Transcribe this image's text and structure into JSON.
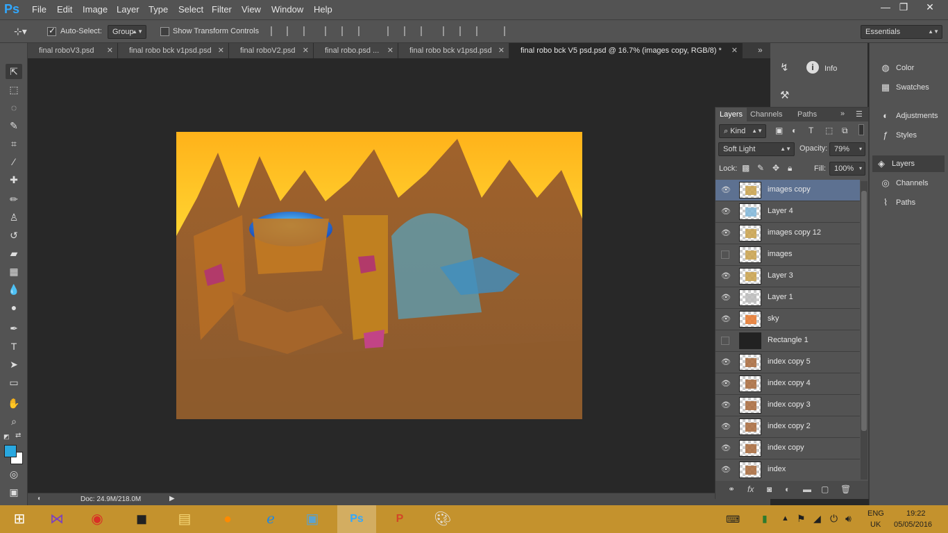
{
  "app": {
    "logo": "Ps"
  },
  "menu": [
    "File",
    "Edit",
    "Image",
    "Layer",
    "Type",
    "Select",
    "Filter",
    "View",
    "Window",
    "Help"
  ],
  "window_controls": {
    "minimize": "—",
    "maximize": "❐",
    "close": "✕"
  },
  "options": {
    "auto_select_label": "Auto-Select:",
    "auto_select_checked": true,
    "auto_select_value": "Group",
    "show_transform_label": "Show Transform Controls",
    "show_transform_checked": false,
    "workspace": "Essentials"
  },
  "tabs": [
    {
      "label": "final roboV3.psd"
    },
    {
      "label": "final robo bck v1psd.psd"
    },
    {
      "label": "final roboV2.psd"
    },
    {
      "label": "final robo.psd ..."
    },
    {
      "label": "final robo bck v1psd.psd"
    },
    {
      "label": "final robo bck V5 psd.psd @ 16.7% (images copy, RGB/8) *",
      "active": true
    }
  ],
  "tab_overflow": "»",
  "status": {
    "doc": "Doc: 24.9M/218.0M"
  },
  "right_dock_top": {
    "info_label": "Info"
  },
  "right_dock_side": [
    {
      "label": "Color",
      "icon": "color-icon"
    },
    {
      "label": "Swatches",
      "icon": "swatches-icon"
    },
    {
      "label": "Adjustments",
      "icon": "adjustments-icon"
    },
    {
      "label": "Styles",
      "icon": "styles-icon"
    },
    {
      "label": "Layers",
      "icon": "layers-icon",
      "active": true
    },
    {
      "label": "Channels",
      "icon": "channels-icon"
    },
    {
      "label": "Paths",
      "icon": "paths-icon"
    }
  ],
  "layers_panel": {
    "tabs": [
      "Layers",
      "Channels",
      "Paths"
    ],
    "filter_kind": "Kind",
    "blend_mode": "Soft Light",
    "opacity_label": "Opacity:",
    "opacity": "79%",
    "lock_label": "Lock:",
    "fill_label": "Fill:",
    "fill": "100%",
    "layers": [
      {
        "name": "images copy",
        "visible": true,
        "selected": true
      },
      {
        "name": "Layer 4",
        "visible": true
      },
      {
        "name": "images copy 12",
        "visible": true
      },
      {
        "name": "images",
        "visible": false
      },
      {
        "name": "Layer 3",
        "visible": true
      },
      {
        "name": "Layer 1",
        "visible": true
      },
      {
        "name": "sky",
        "visible": true
      },
      {
        "name": "Rectangle 1",
        "visible": false
      },
      {
        "name": "index copy 5",
        "visible": true
      },
      {
        "name": "index copy 4",
        "visible": true
      },
      {
        "name": "index copy 3",
        "visible": true
      },
      {
        "name": "index copy 2",
        "visible": true
      },
      {
        "name": "index copy",
        "visible": true
      },
      {
        "name": "index",
        "visible": true
      }
    ]
  },
  "colors": {
    "foreground": "#29a8e0",
    "background": "#ffffff",
    "selected_layer": "#5d7191"
  },
  "taskbar": {
    "language": "ENG",
    "region": "UK",
    "time": "19:22",
    "date": "05/05/2016"
  }
}
